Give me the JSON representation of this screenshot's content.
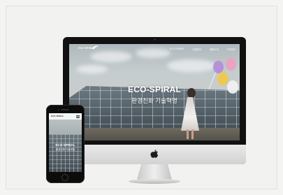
{
  "website": {
    "logo_text": "ECO SPIRAL",
    "nav": [
      "ECO-SPIRAL",
      "사업분야",
      "제품소개",
      "고객센터"
    ],
    "hero_title": "ECO-SPIRAL",
    "hero_subtitle": "환경친화 기술혁명"
  },
  "mobile": {
    "logo_text": "ECO SPIRAL",
    "hero_title": "ECO-SPIRAL",
    "hero_subtitle": "환경친화 기술혁명"
  },
  "colors": {
    "background": "#f2f2f1",
    "device_bezel": "#111111",
    "hero_text": "#ffffff",
    "balloons": [
      "#b48cd8",
      "#f0c94a",
      "#ee9fc4",
      "#f2f2f2"
    ]
  },
  "icons": [
    "apple-logo-icon",
    "hamburger-menu-icon",
    "home-button-icon"
  ]
}
